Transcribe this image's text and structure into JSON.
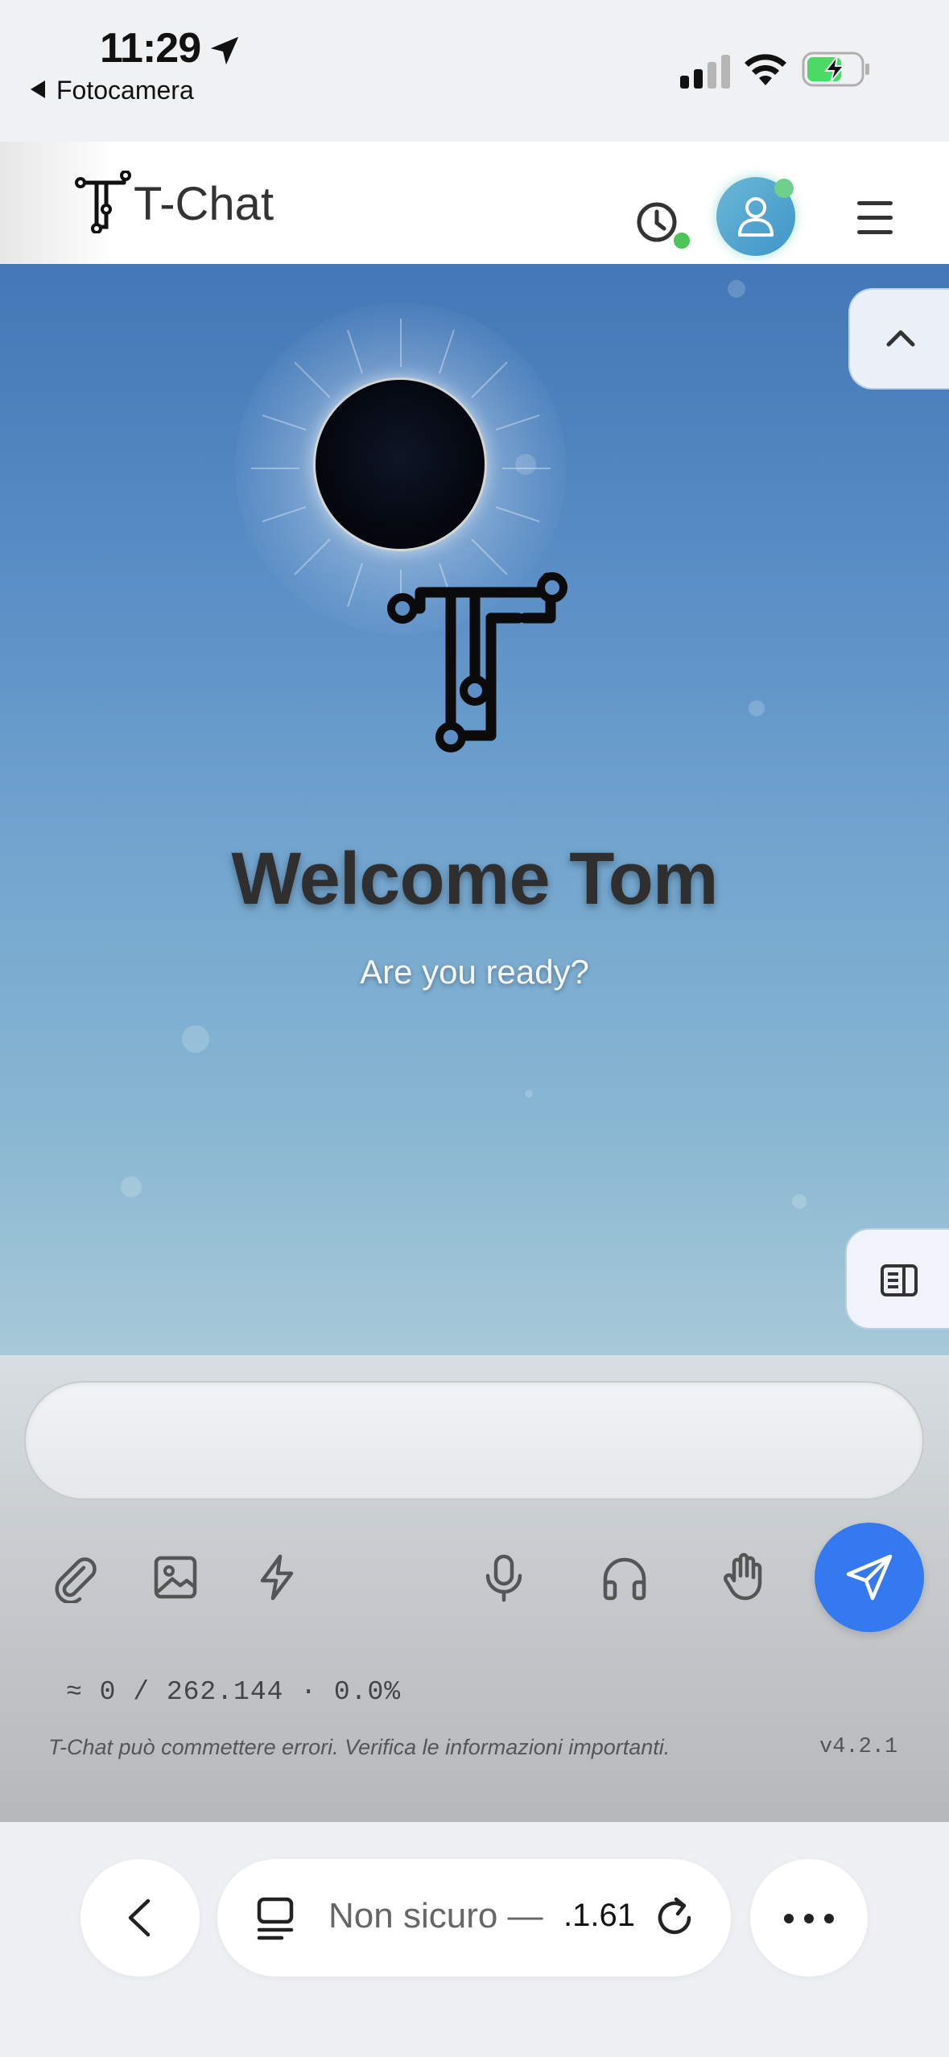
{
  "status_bar": {
    "time": "11:29",
    "back_app": "Fotocamera",
    "icons": [
      "location-arrow-icon",
      "cellular-signal-icon",
      "wifi-icon",
      "battery-charging-icon"
    ]
  },
  "header": {
    "title": "T-Chat",
    "icons": [
      "logo-icon",
      "history-icon",
      "user-icon",
      "menu-icon"
    ],
    "status_color": "#4bc45a"
  },
  "hero": {
    "welcome": "Welcome Tom",
    "subtitle": "Are you ready?"
  },
  "side_buttons": [
    "chevron-up-icon",
    "sidebar-panel-icon"
  ],
  "composer": {
    "input_value": "",
    "input_placeholder": "",
    "tools_left": [
      "paperclip-icon",
      "image-icon",
      "bolt-icon"
    ],
    "tools_right": [
      "microphone-icon",
      "headphones-icon",
      "hand-icon"
    ],
    "send_color": "#3579f0",
    "token_counter": "≈ 0 / 262.144 · 0.0%",
    "disclaimer": "T-Chat può commettere errori. Verifica le informazioni importanti.",
    "version": "v4.2.1"
  },
  "browser": {
    "url_label": "Non sicuro —",
    "url_value": ".1.61",
    "icons": [
      "chevron-left-icon",
      "reader-icon",
      "reload-icon",
      "more-icon"
    ]
  }
}
